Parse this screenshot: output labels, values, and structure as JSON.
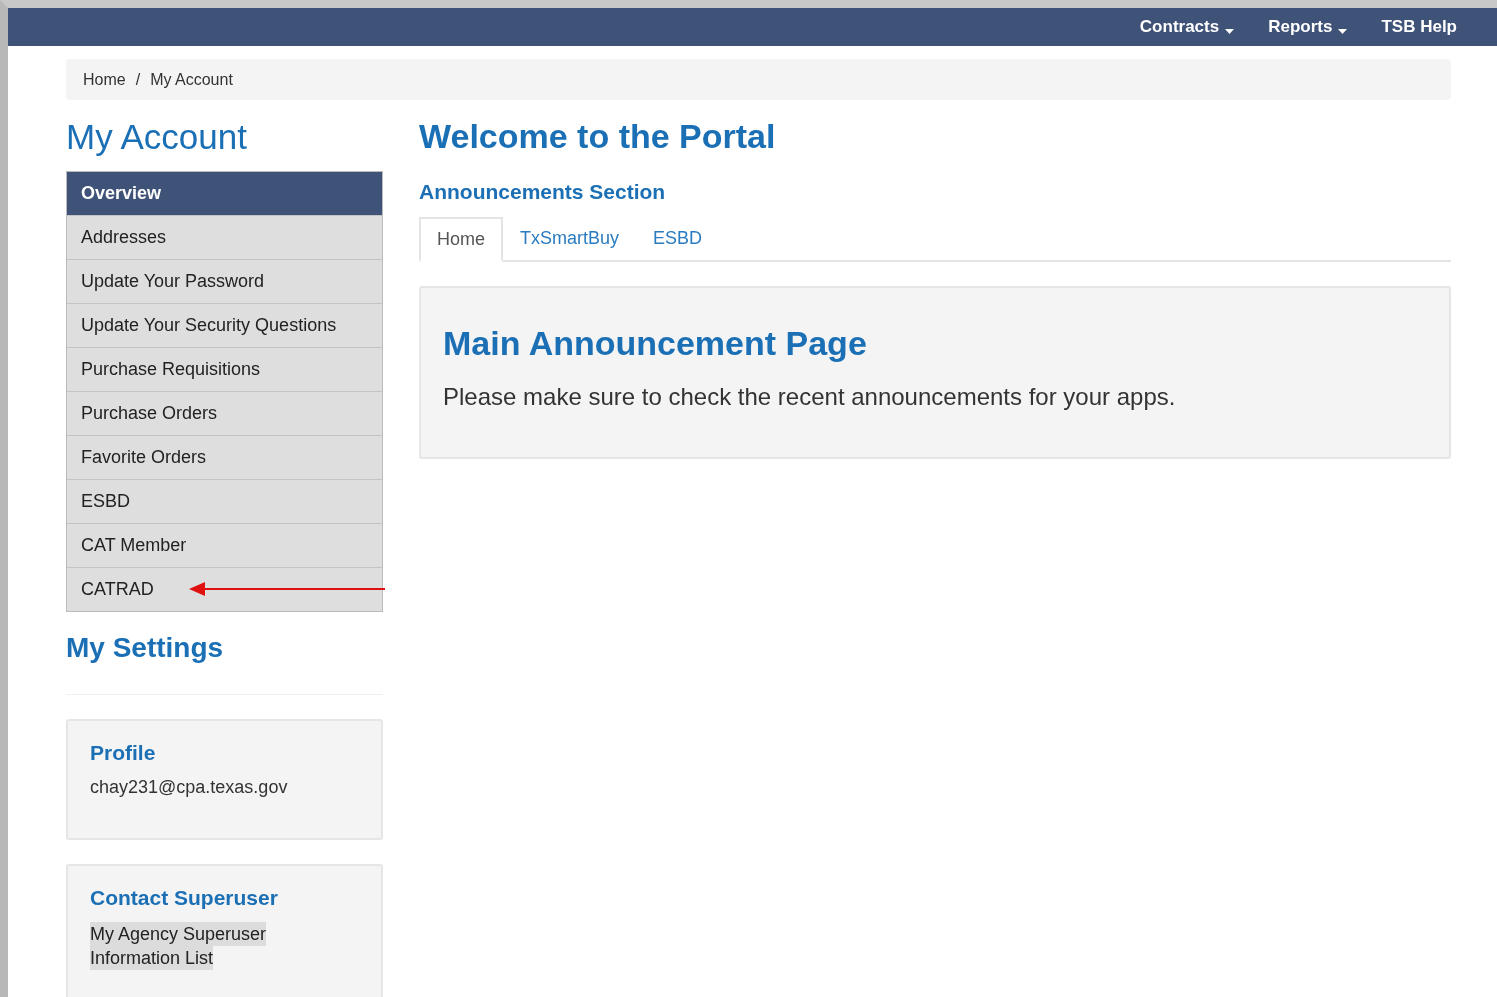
{
  "navbar": {
    "items": [
      {
        "label": "Contracts",
        "dropdown": true
      },
      {
        "label": "Reports",
        "dropdown": true
      },
      {
        "label": "TSB Help",
        "dropdown": false
      }
    ]
  },
  "breadcrumb": {
    "separator": "/",
    "items": [
      "Home",
      "My Account"
    ]
  },
  "sidebar": {
    "title": "My Account",
    "items": [
      {
        "label": "Overview",
        "selected": true
      },
      {
        "label": "Addresses",
        "selected": false
      },
      {
        "label": "Update Your Password",
        "selected": false
      },
      {
        "label": "Update Your Security Questions",
        "selected": false
      },
      {
        "label": "Purchase Requisitions",
        "selected": false
      },
      {
        "label": "Purchase Orders",
        "selected": false
      },
      {
        "label": "Favorite Orders",
        "selected": false
      },
      {
        "label": "ESBD",
        "selected": false
      },
      {
        "label": "CAT Member",
        "selected": false
      },
      {
        "label": "CATRAD",
        "selected": false,
        "pointed_at": true
      }
    ],
    "settings_title": "My Settings",
    "profile": {
      "title": "Profile",
      "email": "chay231@cpa.texas.gov"
    },
    "contact": {
      "title": "Contact Superuser",
      "link_lines": [
        "My Agency Superuser",
        "Information List"
      ]
    }
  },
  "main": {
    "title": "Welcome to the Portal",
    "section_title": "Announcements Section",
    "tabs": [
      {
        "label": "Home",
        "selected": true
      },
      {
        "label": "TxSmartBuy",
        "selected": false
      },
      {
        "label": "ESBD",
        "selected": false
      }
    ],
    "panel": {
      "title": "Main Announcement Page",
      "text": "Please make sure to check the recent announcements for your apps."
    }
  }
}
